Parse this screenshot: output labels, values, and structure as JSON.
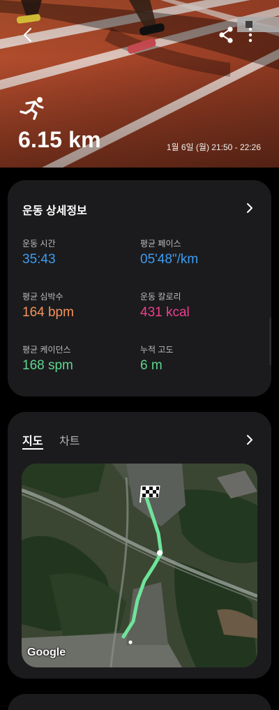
{
  "hero": {
    "distance": "6.15 km",
    "datetime": "1월 6일 (월) 21:50 - 22:26"
  },
  "detail_card": {
    "title": "운동 상세정보",
    "stats": [
      {
        "label": "운동 시간",
        "value": "35:43",
        "color": "#3d9df2"
      },
      {
        "label": "평균 페이스",
        "value": "05'48\"/km",
        "color": "#3d9df2"
      },
      {
        "label": "평균 심박수",
        "value": "164 bpm",
        "color": "#f2945c"
      },
      {
        "label": "운동 칼로리",
        "value": "431 kcal",
        "color": "#ee3e8e"
      },
      {
        "label": "평균 케이던스",
        "value": "168 spm",
        "color": "#5fd68f"
      },
      {
        "label": "누적 고도",
        "value": "6 m",
        "color": "#5fd68f"
      }
    ]
  },
  "map_card": {
    "tabs": [
      {
        "label": "지도",
        "selected": true
      },
      {
        "label": "차트",
        "selected": false
      }
    ],
    "attribution": "Google",
    "route_color": "#6fe39a"
  },
  "icons": {
    "back": "back-arrow-icon",
    "share": "share-icon",
    "more": "more-vert-icon",
    "activity": "running-icon",
    "chevron": "chevron-right-icon",
    "finish": "checkered-flag-icon"
  }
}
